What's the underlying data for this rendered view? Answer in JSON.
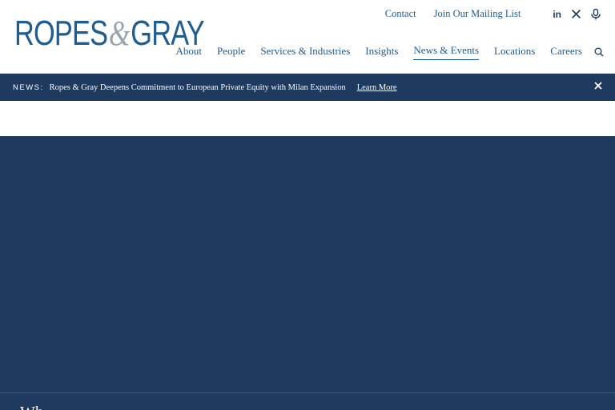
{
  "brand": {
    "logo_left": "ROPES",
    "logo_amp": "&",
    "logo_right": "GRAY"
  },
  "utility_nav": {
    "contact": "Contact",
    "mailing_list": "Join Our Mailing List"
  },
  "social": {
    "linkedin_label": "in",
    "x_label": "𝕏"
  },
  "main_nav": {
    "items": [
      "About",
      "People",
      "Services & Industries",
      "Insights",
      "News & Events",
      "Locations",
      "Careers"
    ],
    "active": "News & Events"
  },
  "news_banner": {
    "tag": "NEWS:",
    "headline": "Ropes & Gray Deepens Commitment to European Private Equity with Milan Expansion",
    "cta": "Learn More"
  },
  "hero": {
    "title": "Wh"
  },
  "colors": {
    "navy": "#1f3a5f",
    "link_blue": "#1f5c8f",
    "logo_gray": "#9aa3ad"
  }
}
